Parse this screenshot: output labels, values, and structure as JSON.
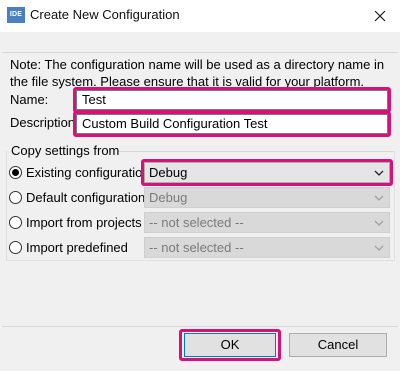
{
  "window": {
    "app_icon_text": "IDE",
    "title": "Create New Configuration",
    "close_icon": "close-icon"
  },
  "note": "Note: The configuration name will be used as a directory name in the file system.  Please ensure that it is valid for your platform.",
  "name_field": {
    "label": "Name:",
    "value": "Test"
  },
  "description_field": {
    "label": "Description:",
    "value": "Custom Build Configuration Test"
  },
  "copy_settings": {
    "title": "Copy settings from",
    "options": [
      {
        "label": "Existing configuration",
        "selected": true,
        "combo_value": "Debug",
        "combo_enabled": true
      },
      {
        "label": "Default configuration",
        "selected": false,
        "combo_value": "Debug",
        "combo_enabled": false
      },
      {
        "label": "Import from projects",
        "selected": false,
        "combo_value": "-- not selected --",
        "combo_enabled": false
      },
      {
        "label": "Import predefined",
        "selected": false,
        "combo_value": "-- not selected --",
        "combo_enabled": false
      }
    ]
  },
  "buttons": {
    "ok": "OK",
    "cancel": "Cancel"
  },
  "colors": {
    "highlight": "#d6127a",
    "default_button_border": "#0078d7",
    "dialog_bg": "#f0f0f0"
  }
}
